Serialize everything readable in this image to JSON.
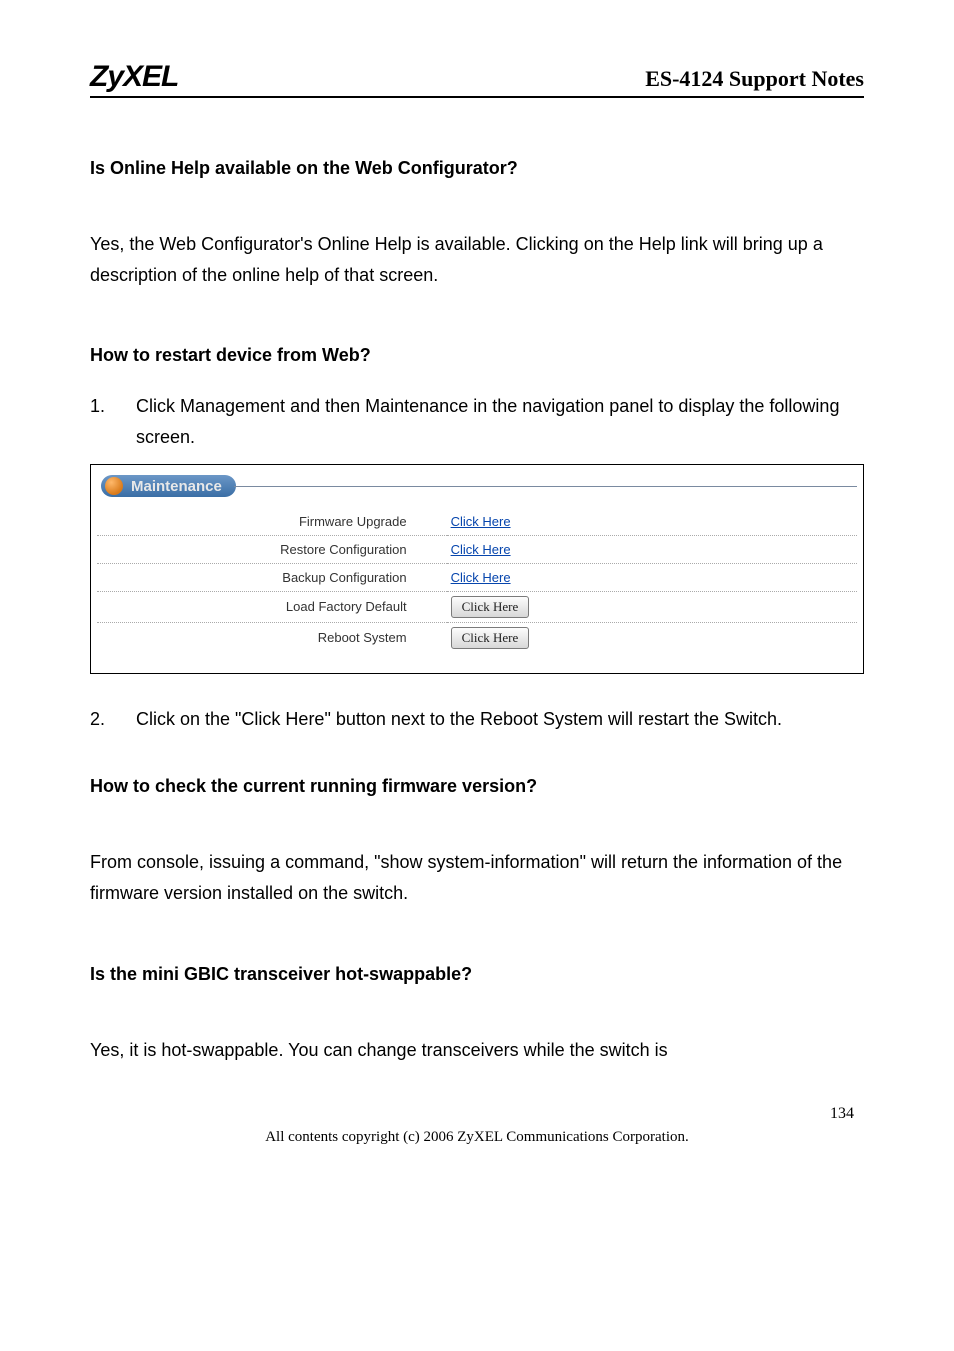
{
  "header": {
    "brand": "ZyXEL",
    "doc_title": "ES-4124 Support Notes"
  },
  "sections": {
    "q1_heading": "Is Online Help available on the Web Configurator?",
    "q1_body": "Yes, the Web Configurator's Online Help is available. Clicking on the Help link will bring up a description of the online help of that screen.",
    "q2_heading": "How to restart device from Web?",
    "q2_step1_num": "1.",
    "q2_step1": "Click Management and then Maintenance in the navigation panel to display the following screen.",
    "q2_step2_num": "2.",
    "q2_step2": "Click on the \"Click Here\" button next to the Reboot System will restart the Switch.",
    "q3_heading": "How to check the current running firmware version?",
    "q3_body": "From console, issuing a command, \"show system-information\" will return the information of the firmware version installed on the switch.",
    "q4_heading": "Is the mini GBIC transceiver hot-swappable?",
    "q4_body": "Yes, it is hot-swappable. You can change transceivers while the switch is"
  },
  "maintenance": {
    "title": "Maintenance",
    "rows": [
      {
        "label": "Firmware Upgrade",
        "action_type": "link",
        "action_text": "Click Here"
      },
      {
        "label": "Restore Configuration",
        "action_type": "link",
        "action_text": "Click Here"
      },
      {
        "label": "Backup Configuration",
        "action_type": "link",
        "action_text": "Click Here"
      },
      {
        "label": "Load Factory Default",
        "action_type": "button",
        "action_text": "Click Here"
      },
      {
        "label": "Reboot System",
        "action_type": "button",
        "action_text": "Click Here"
      }
    ]
  },
  "footer": {
    "page_no": "134",
    "copyright": "All contents copyright (c) 2006 ZyXEL Communications Corporation."
  }
}
